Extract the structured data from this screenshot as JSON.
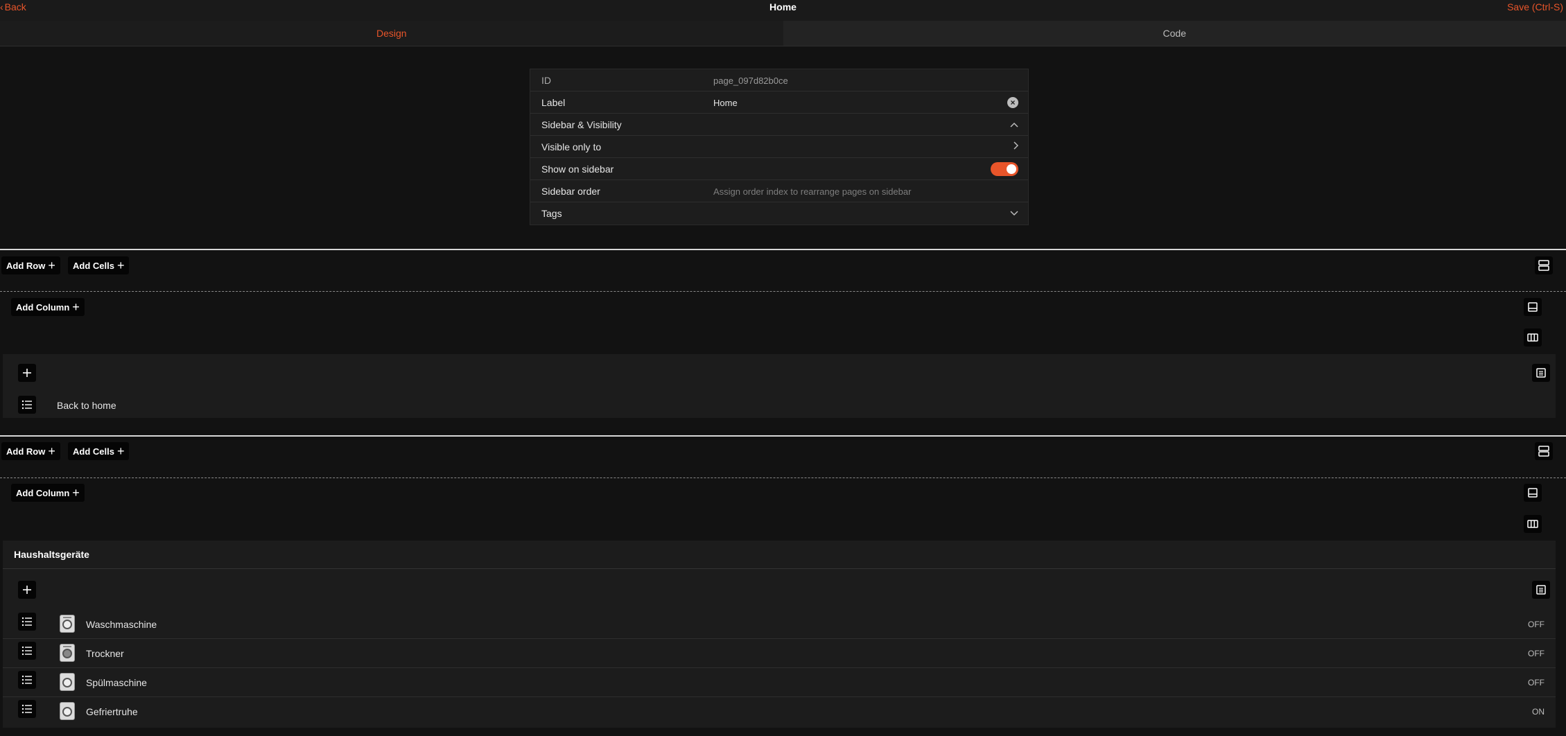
{
  "topbar": {
    "back_label": "Back",
    "title": "Home",
    "save_label": "Save (Ctrl-S)"
  },
  "tabs": [
    {
      "label": "Design"
    },
    {
      "label": "Code"
    }
  ],
  "props": {
    "id_key": "ID",
    "id_value": "page_097d82b0ce",
    "label_key": "Label",
    "label_value": "Home",
    "sidebar_visibility": "Sidebar & Visibility",
    "visible_only_to": "Visible only to",
    "show_on_sidebar": "Show on sidebar",
    "sidebar_order": "Sidebar order",
    "sidebar_order_placeholder": "Assign order index to rearrange pages on sidebar",
    "tags": "Tags"
  },
  "toolbar": {
    "add_row": "Add Row",
    "add_cells": "Add Cells",
    "add_column": "Add Column"
  },
  "cell1": {
    "item_label": "Back to home"
  },
  "cell2": {
    "title": "Haushaltsgeräte",
    "entities": [
      {
        "name": "Waschmaschine",
        "state": "OFF"
      },
      {
        "name": "Trockner",
        "state": "OFF"
      },
      {
        "name": "Spülmaschine",
        "state": "OFF"
      },
      {
        "name": "Gefriertruhe",
        "state": "ON"
      }
    ]
  },
  "colors": {
    "accent": "#e8552a",
    "background": "#121212",
    "panel": "#1c1c1c"
  }
}
